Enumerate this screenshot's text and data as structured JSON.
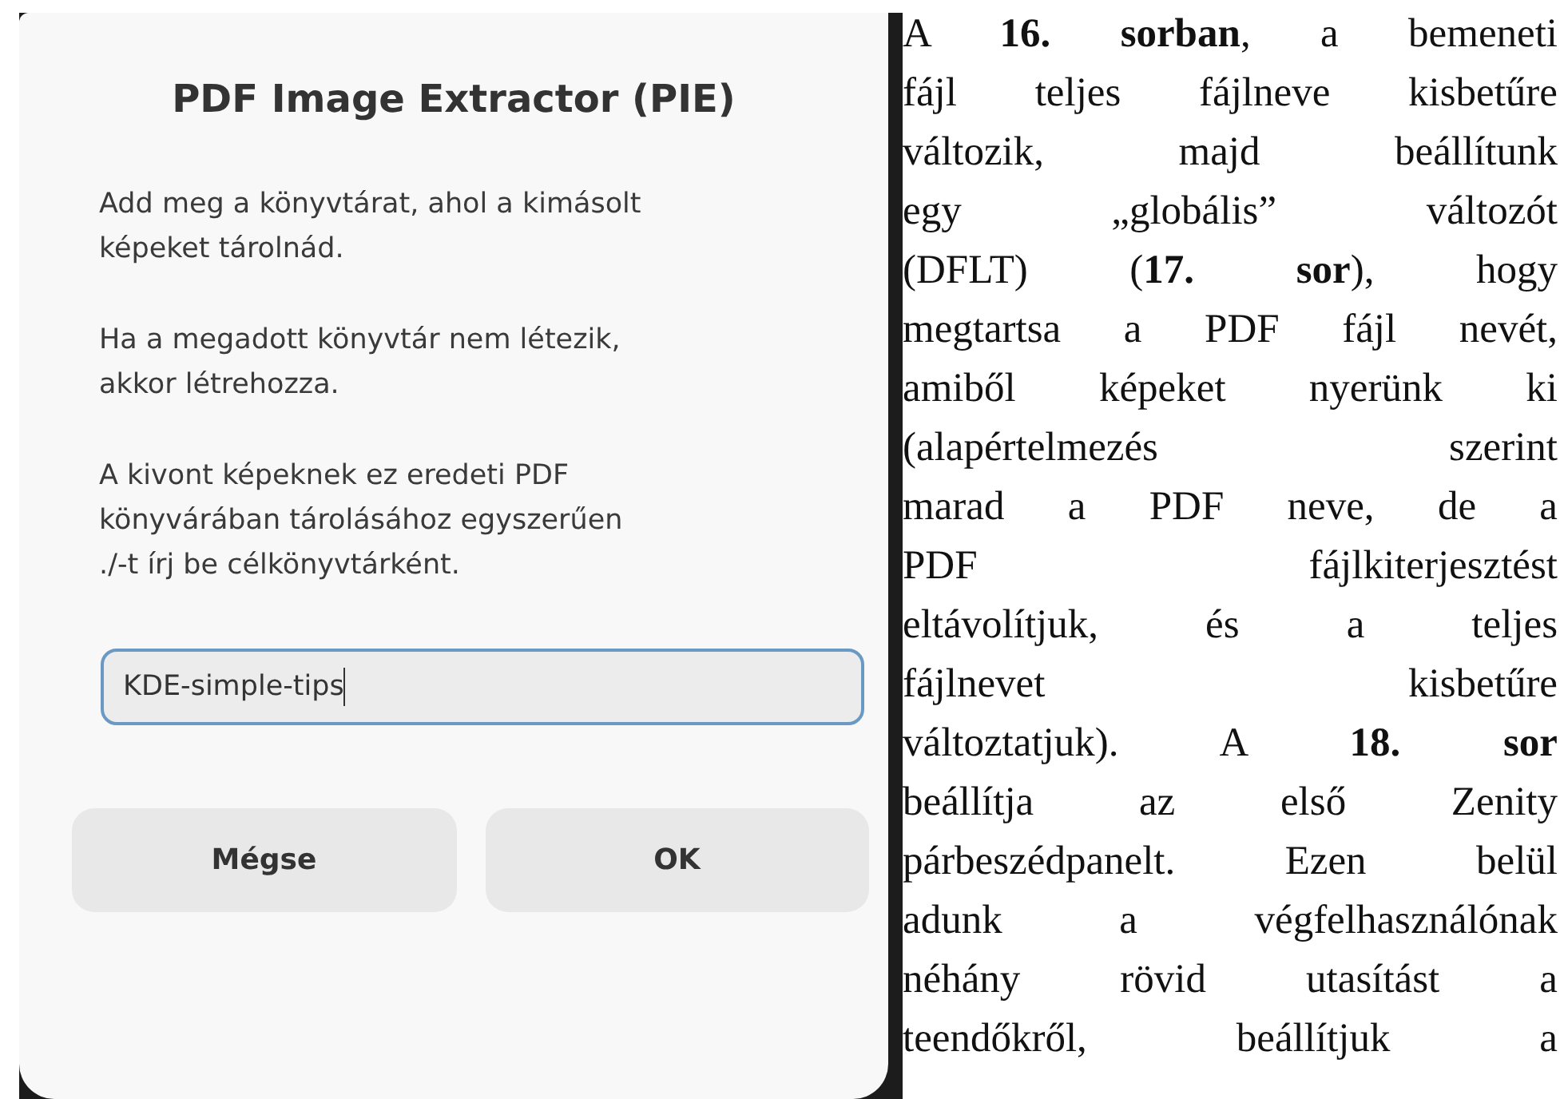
{
  "dialog": {
    "title": "PDF Image Extractor (PIE)",
    "paragraphs": [
      {
        "lines": [
          "Add meg a könyvtárat, ahol a kimásolt",
          "képeket tárolnád."
        ]
      },
      {
        "lines": [
          "Ha a megadott könyvtár nem létezik,",
          "akkor létrehozza."
        ]
      },
      {
        "lines": [
          "A kivont képeknek ez eredeti PDF",
          "könyvárában tárolásához egyszerűen",
          "./-t írj be célkönyvtárként."
        ]
      }
    ],
    "input": {
      "value": "KDE-simple-tips",
      "focused": true
    },
    "buttons": [
      "Mégse",
      "OK"
    ]
  },
  "article": {
    "lines": [
      "A **16. sorban**, a bemeneti",
      "fájl teljes fájlneve kisbetűre",
      "változik, majd beállítunk",
      "egy „globális” változót",
      "(DFLT) (**17. sor**), hogy",
      "megtartsa a PDF fájl nevét,",
      "amiből képeket nyerünk ki",
      "(alapértelmezés szerint",
      "marad a PDF neve, de a",
      "PDF fájlkiterjesztést",
      "eltávolítjuk, és a teljes",
      "fájlnevet kisbetűre",
      "változtatjuk). A **18. sor**",
      "beállítja az első Zenity",
      "párbeszédpanelt. Ezen belül",
      "adunk a végfelhasználónak",
      "néhány rövid utasítást a",
      "teendőkről, beállítjuk a"
    ]
  }
}
